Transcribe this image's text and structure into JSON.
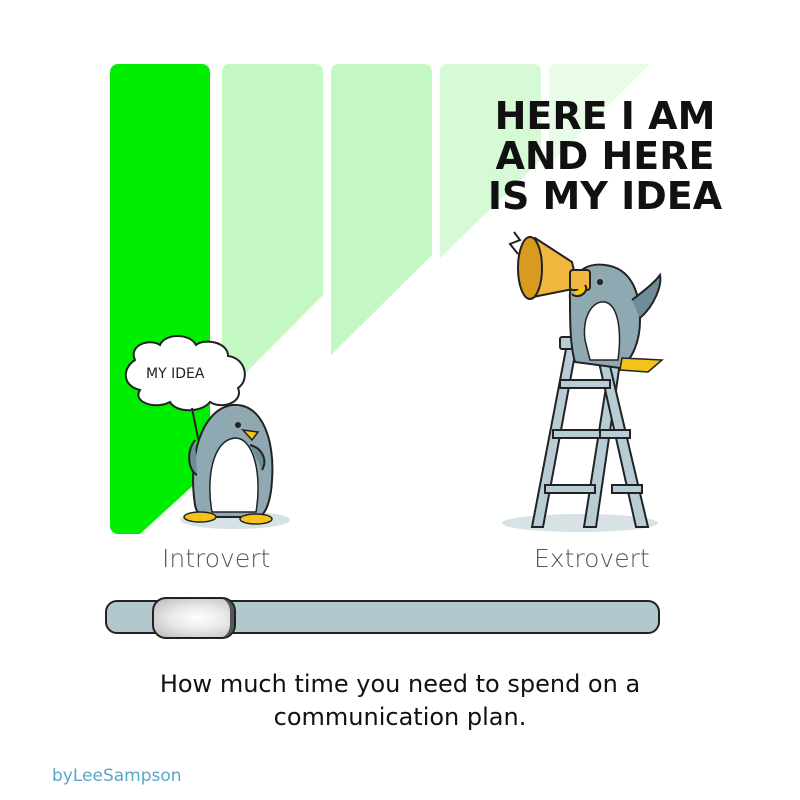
{
  "shout": {
    "lines": [
      "HERE I AM",
      "AND HERE",
      "IS MY IDEA"
    ]
  },
  "thought": {
    "text": "MY IDEA"
  },
  "labels": {
    "introvert": "Introvert",
    "extrovert": "Extrovert"
  },
  "slider": {
    "value": 0.1
  },
  "caption": {
    "line1": "How much time you need to spend on a",
    "line2": "communication plan."
  },
  "credit": "byLeeSampson",
  "colors": {
    "bar_bright": "#00ee00",
    "bar_light": "#c3f7c3",
    "bar_lighter": "#d9f9d9",
    "penguin_body": "#8fa9b3",
    "penguin_dark": "#6e8c99",
    "beak_yellow": "#f4c41a",
    "megaphone": "#f0b63d",
    "ladder": "#b7ccd4",
    "track": "#b2c7ce",
    "credit": "#5aa7c9"
  },
  "icons": [
    "thought-bubble-icon",
    "penguin-icon",
    "megaphone-icon",
    "ladder-icon",
    "slider-thumb-icon"
  ]
}
